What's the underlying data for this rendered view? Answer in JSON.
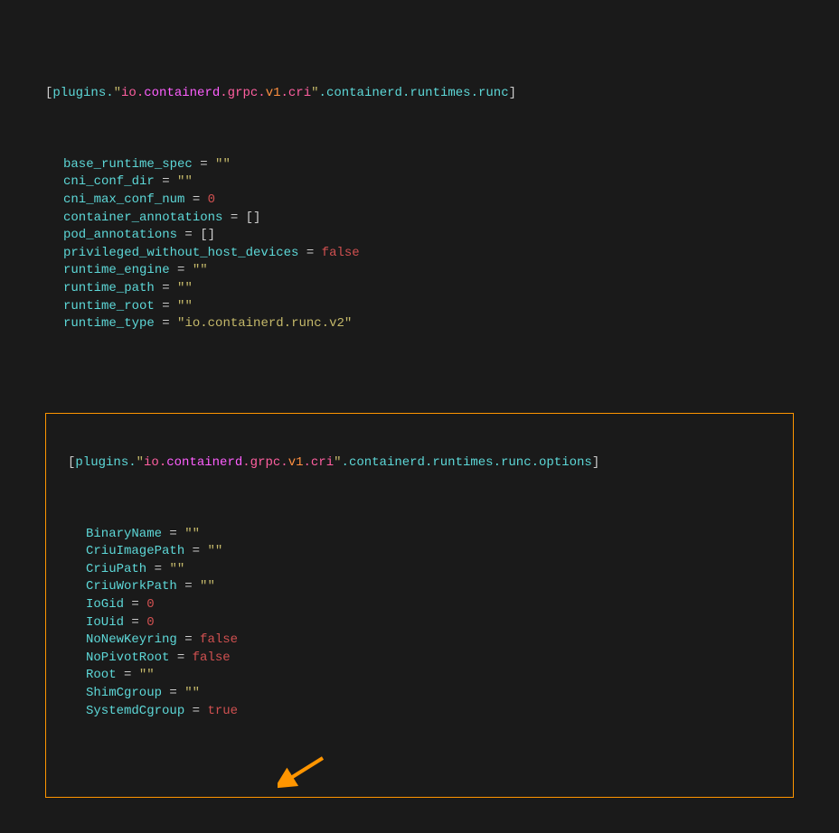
{
  "section1": {
    "header": {
      "bracket_open": "[",
      "plugins": "plugins",
      "dot1": ".",
      "q1": "\"",
      "io": "io",
      "dot2": ".",
      "containerd1": "containerd",
      "dot3": ".",
      "grpc": "grpc",
      "dot4": ".",
      "v1": "v1",
      "dot5": ".",
      "cri": "cri",
      "q2": "\"",
      "dot6": ".",
      "containerd2": "containerd",
      "dot7": ".",
      "runtimes": "runtimes",
      "dot8": ".",
      "runc": "runc",
      "bracket_close": "]"
    },
    "lines": [
      {
        "key": "base_runtime_spec",
        "eq": " = ",
        "val": "\"\"",
        "type": "str"
      },
      {
        "key": "cni_conf_dir",
        "eq": " = ",
        "val": "\"\"",
        "type": "str"
      },
      {
        "key": "cni_max_conf_num",
        "eq": " = ",
        "val": "0",
        "type": "num"
      },
      {
        "key": "container_annotations",
        "eq": " = ",
        "val": "[]",
        "type": "punc"
      },
      {
        "key": "pod_annotations",
        "eq": " = ",
        "val": "[]",
        "type": "punc"
      },
      {
        "key": "privileged_without_host_devices",
        "eq": " = ",
        "val": "false",
        "type": "kw"
      },
      {
        "key": "runtime_engine",
        "eq": " = ",
        "val": "\"\"",
        "type": "str"
      },
      {
        "key": "runtime_path",
        "eq": " = ",
        "val": "\"\"",
        "type": "str"
      },
      {
        "key": "runtime_root",
        "eq": " = ",
        "val": "\"\"",
        "type": "str"
      },
      {
        "key": "runtime_type",
        "eq": " = ",
        "val": "\"io.containerd.runc.v2\"",
        "type": "str"
      }
    ]
  },
  "section2": {
    "header": {
      "bracket_open": "[",
      "plugins": "plugins",
      "dot1": ".",
      "q1": "\"",
      "io": "io",
      "dot2": ".",
      "containerd1": "containerd",
      "dot3": ".",
      "grpc": "grpc",
      "dot4": ".",
      "v1": "v1",
      "dot5": ".",
      "cri": "cri",
      "q2": "\"",
      "dot6": ".",
      "containerd2": "containerd",
      "dot7": ".",
      "runtimes": "runtimes",
      "dot8": ".",
      "runc": "runc",
      "dot9": ".",
      "options": "options",
      "bracket_close": "]"
    },
    "lines": [
      {
        "key": "BinaryName",
        "eq": " = ",
        "val": "\"\"",
        "type": "str"
      },
      {
        "key": "CriuImagePath",
        "eq": " = ",
        "val": "\"\"",
        "type": "str"
      },
      {
        "key": "CriuPath",
        "eq": " = ",
        "val": "\"\"",
        "type": "str"
      },
      {
        "key": "CriuWorkPath",
        "eq": " = ",
        "val": "\"\"",
        "type": "str"
      },
      {
        "key": "IoGid",
        "eq": " = ",
        "val": "0",
        "type": "num"
      },
      {
        "key": "IoUid",
        "eq": " = ",
        "val": "0",
        "type": "num"
      },
      {
        "key": "NoNewKeyring",
        "eq": " = ",
        "val": "false",
        "type": "kw"
      },
      {
        "key": "NoPivotRoot",
        "eq": " = ",
        "val": "false",
        "type": "kw"
      },
      {
        "key": "Root",
        "eq": " = ",
        "val": "\"\"",
        "type": "str"
      },
      {
        "key": "ShimCgroup",
        "eq": " = ",
        "val": "\"\"",
        "type": "str"
      },
      {
        "key": "SystemdCgroup",
        "eq": " = ",
        "val": "true",
        "type": "kw"
      }
    ]
  }
}
